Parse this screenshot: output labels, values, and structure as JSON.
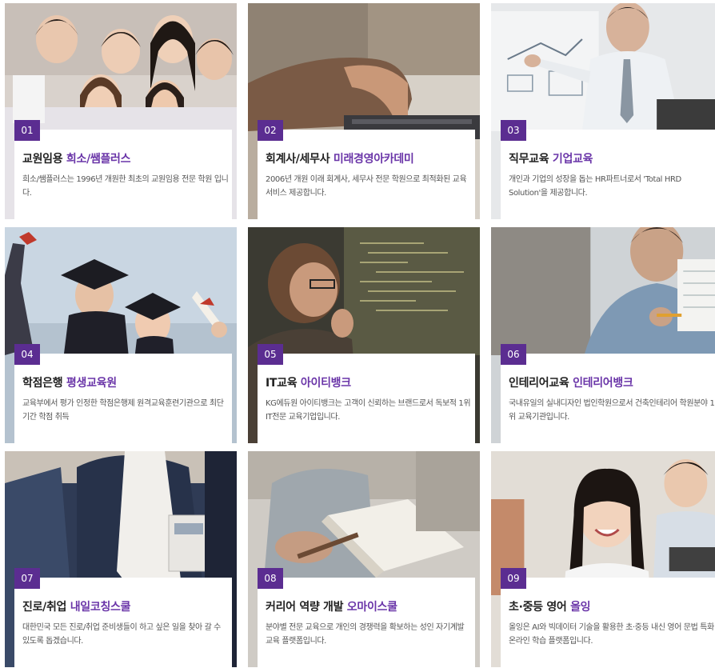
{
  "colors": {
    "accent": "#5b2d91",
    "highlight": "#6a35a8"
  },
  "cards": [
    {
      "num": "01",
      "title_plain": "교원임용 ",
      "title_hl": "희소/쌤플러스",
      "desc": "희소/쌤플러스는 1996년 개원한 최초의 교원임용 전문 학원 입니다.",
      "image": "students-photo"
    },
    {
      "num": "02",
      "title_plain": "회계사/세무사 ",
      "title_hl": "미래경영아카데미",
      "desc": "2006년 개원 이래 회계사, 세무사 전문 학원으로 최적화된 교육 서비스 제공합니다.",
      "image": "laptop-typing-photo"
    },
    {
      "num": "03",
      "title_plain": "직무교육 ",
      "title_hl": "기업교육",
      "desc": "개인과 기업의 성장을 돕는 HR파트너로서 'Total HRD Solution'을 제공합니다.",
      "image": "whiteboard-presenter-photo"
    },
    {
      "num": "04",
      "title_plain": "학점은행 ",
      "title_hl": "평생교육원",
      "desc": "교육부에서 평가 인정한 학점은행제 원격교육훈련기관으로 최단기간 학점 취득",
      "image": "graduates-photo"
    },
    {
      "num": "05",
      "title_plain": "IT교육 ",
      "title_hl": "아이티뱅크",
      "desc": "KG에듀원 아이티뱅크는 고객이 신뢰하는 브랜드로서 독보적 1위 IT전문 교육기업입니다.",
      "image": "programmer-screen-photo"
    },
    {
      "num": "06",
      "title_plain": "인테리어교육 ",
      "title_hl": "인테리어뱅크",
      "desc": "국내유일의 실내디자인 법인학원으로서 건축인테리어 학원분야 1위 교육기관입니다.",
      "image": "designer-drawing-photo"
    },
    {
      "num": "07",
      "title_plain": "진로/취업 ",
      "title_hl": "내일코칭스쿨",
      "desc": "대한민국 모든 진로/취업 준비생들이 하고 싶은 일을 찾아 갈 수 있도록 돕겠습니다.",
      "image": "suit-badge-photo"
    },
    {
      "num": "08",
      "title_plain": "커리어 역량 개발 ",
      "title_hl": "오마이스쿨",
      "desc": "분야별 전문 교육으로 개인의 경쟁력을 확보하는 성인 자기계발 교육 플랫폼입니다.",
      "image": "reading-book-photo"
    },
    {
      "num": "09",
      "title_plain": "초·중등 영어 ",
      "title_hl": "올잉",
      "desc": "올잉은 AI와 빅데이터 기술을 활용한 초·중등 내신 영어 문법 특화 온라인 학습 플랫폼입니다.",
      "image": "kids-smiling-photo"
    }
  ]
}
